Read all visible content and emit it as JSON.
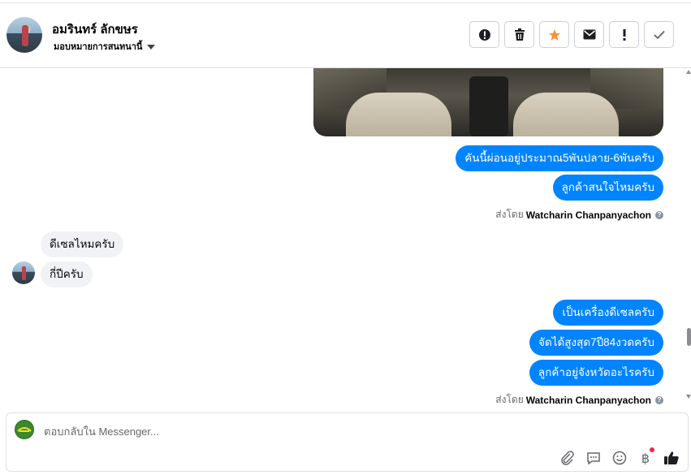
{
  "header": {
    "contact_name": "อมรินทร์ ลักขษร",
    "assign_label": "มอบหมายการสนทนานี้",
    "actions": [
      "alert-icon",
      "trash-icon",
      "star-icon",
      "mail-icon",
      "exclamation-icon",
      "check-icon"
    ],
    "star_color": "#f7923a"
  },
  "messages": {
    "out_group1": [
      "คันนี้ผ่อนอยู่ประมาณ5พันปลาย-6พันครับ",
      "ลูกค้าสนใจไหมครับ"
    ],
    "sent_by_1": {
      "prefix": "ส่งโดย",
      "name": "Watcharin Chanpanyachon"
    },
    "in_group": [
      "ดีเซลไหมครับ",
      "กี่ปีครับ"
    ],
    "out_group2": [
      "เป็นเครื่องดีเซลครับ",
      "จัดได้สูงสุด7ปี84งวดครับ",
      "ลูกค้าอยู่จังหวัดอะไรครับ"
    ],
    "sent_by_2": {
      "prefix": "ส่งโดย",
      "name": "Watcharin Chanpanyachon"
    }
  },
  "composer": {
    "placeholder": "ตอบกลับใน Messenger...",
    "tools": [
      "paperclip-icon",
      "saved-reply-icon",
      "emoji-icon",
      "baht-icon",
      "like-icon"
    ],
    "baht_symbol": "฿"
  },
  "colors": {
    "bubble_out": "#0084ff",
    "bubble_in": "#f0f2f5"
  }
}
